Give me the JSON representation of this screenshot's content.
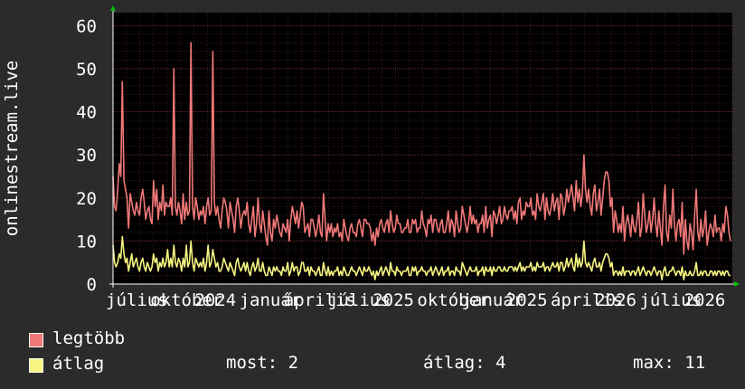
{
  "chart_data": {
    "type": "line",
    "ylabel": "onlinestream.live",
    "ylim": [
      0,
      63
    ],
    "yticks": [
      "0",
      "10",
      "20",
      "30",
      "40",
      "50",
      "60"
    ],
    "xticks": [
      "július",
      "október",
      "2024",
      "január",
      "április",
      "július",
      "2025",
      "október",
      "január",
      "2025",
      "április",
      "2026",
      "július",
      "2026"
    ],
    "grid": true,
    "series": [
      {
        "name": "legtöbb",
        "color": "#f07878",
        "values": [
          25,
          18,
          17,
          22,
          28,
          25,
          47,
          24,
          22,
          20,
          13,
          21,
          19,
          17,
          16,
          19,
          17,
          16,
          20,
          22,
          19,
          15,
          17,
          18,
          15,
          14,
          24,
          18,
          22,
          15,
          19,
          17,
          23,
          16,
          19,
          18,
          18,
          20,
          16,
          50,
          18,
          16,
          19,
          17,
          14,
          21,
          15,
          19,
          16,
          17,
          56,
          18,
          15,
          20,
          18,
          15,
          17,
          16,
          18,
          14,
          18,
          20,
          16,
          17,
          54,
          19,
          16,
          18,
          15,
          13,
          17,
          20,
          19,
          17,
          13,
          19,
          17,
          15,
          12,
          18,
          20,
          17,
          13,
          16,
          17,
          16,
          19,
          14,
          12,
          15,
          18,
          11,
          14,
          20,
          14,
          12,
          17,
          14,
          11,
          9,
          17,
          12,
          10,
          15,
          13,
          16,
          14,
          12,
          11,
          14,
          13,
          12,
          15,
          10,
          15,
          18,
          16,
          14,
          17,
          13,
          16,
          19,
          18,
          12,
          13,
          14,
          11,
          15,
          15,
          13,
          11,
          13,
          16,
          12,
          11,
          21,
          15,
          10,
          14,
          12,
          14,
          11,
          13,
          12,
          14,
          11,
          12,
          10,
          15,
          13,
          11,
          10,
          13,
          14,
          12,
          12,
          11,
          14,
          15,
          13,
          11,
          15,
          15,
          14,
          14,
          13,
          10,
          12,
          9,
          13,
          11,
          14,
          15,
          13,
          12,
          14,
          15,
          12,
          17,
          14,
          12,
          13,
          16,
          14,
          14,
          12,
          12,
          13,
          13,
          15,
          12,
          12,
          15,
          14,
          15,
          12,
          13,
          13,
          17,
          14,
          13,
          11,
          15,
          14,
          16,
          12,
          15,
          15,
          13,
          12,
          14,
          15,
          12,
          12,
          14,
          17,
          12,
          15,
          14,
          11,
          17,
          14,
          12,
          13,
          18,
          16,
          14,
          12,
          14,
          18,
          14,
          16,
          14,
          15,
          12,
          14,
          14,
          16,
          12,
          18,
          13,
          15,
          16,
          11,
          17,
          16,
          14,
          16,
          18,
          14,
          15,
          18,
          16,
          15,
          17,
          17,
          18,
          15,
          17,
          14,
          19,
          20,
          15,
          17,
          16,
          19,
          18,
          18,
          20,
          16,
          17,
          15,
          21,
          18,
          17,
          19,
          21,
          15,
          20,
          17,
          16,
          18,
          21,
          17,
          19,
          20,
          15,
          21,
          20,
          16,
          18,
          22,
          19,
          21,
          23,
          20,
          17,
          24,
          19,
          22,
          18,
          21,
          30,
          22,
          19,
          22,
          18,
          16,
          21,
          23,
          17,
          19,
          22,
          16,
          20,
          24,
          26,
          26,
          24,
          18,
          20,
          12,
          17,
          15,
          12,
          14,
          12,
          18,
          10,
          14,
          16,
          14,
          11,
          16,
          13,
          12,
          15,
          19,
          11,
          13,
          21,
          16,
          12,
          14,
          17,
          12,
          15,
          20,
          14,
          11,
          17,
          13,
          9,
          18,
          23,
          12,
          10,
          16,
          13,
          22,
          14,
          10,
          14,
          15,
          11,
          19,
          7,
          15,
          10,
          8,
          14,
          12,
          8,
          16,
          22,
          12,
          10,
          15,
          11,
          13,
          17,
          9,
          12,
          14,
          13,
          11,
          16,
          12,
          13,
          13,
          10,
          14,
          12,
          18,
          16,
          12,
          10
        ]
      },
      {
        "name": "átlag",
        "color": "#f5f580",
        "values": [
          9,
          5,
          4,
          5,
          7,
          6,
          11,
          7,
          5,
          6,
          3,
          5,
          7,
          4,
          5,
          6,
          4,
          3,
          5,
          6,
          4,
          3,
          5,
          4,
          3,
          4,
          7,
          5,
          6,
          3,
          5,
          4,
          6,
          4,
          5,
          8,
          4,
          6,
          4,
          9,
          5,
          4,
          6,
          5,
          3,
          6,
          4,
          9,
          4,
          5,
          10,
          5,
          3,
          6,
          5,
          4,
          5,
          4,
          6,
          3,
          5,
          9,
          4,
          5,
          8,
          6,
          4,
          5,
          3,
          3,
          4,
          6,
          5,
          4,
          3,
          5,
          4,
          3,
          2,
          5,
          6,
          4,
          3,
          4,
          5,
          3,
          5,
          3,
          2,
          4,
          5,
          3,
          4,
          6,
          3,
          3,
          5,
          3,
          2,
          2,
          4,
          3,
          2,
          4,
          3,
          4,
          3,
          3,
          2,
          4,
          3,
          3,
          5,
          2,
          3,
          5,
          3,
          4,
          4,
          2,
          3,
          5,
          5,
          3,
          3,
          4,
          2,
          4,
          3,
          3,
          2,
          3,
          4,
          2,
          2,
          5,
          3,
          2,
          4,
          2,
          3,
          2,
          3,
          3,
          4,
          2,
          3,
          2,
          4,
          3,
          2,
          2,
          3,
          4,
          3,
          3,
          2,
          3,
          4,
          3,
          2,
          4,
          3,
          3,
          4,
          3,
          2,
          3,
          1,
          3,
          2,
          3,
          4,
          2,
          3,
          4,
          3,
          2,
          5,
          3,
          3,
          2,
          4,
          3,
          3,
          2,
          3,
          3,
          3,
          4,
          2,
          2,
          4,
          3,
          4,
          2,
          3,
          3,
          4,
          3,
          3,
          2,
          3,
          3,
          4,
          2,
          3,
          4,
          3,
          2,
          3,
          4,
          2,
          3,
          3,
          4,
          2,
          3,
          3,
          2,
          4,
          3,
          3,
          2,
          5,
          4,
          3,
          2,
          3,
          4,
          3,
          3,
          3,
          4,
          2,
          3,
          3,
          4,
          2,
          4,
          3,
          3,
          4,
          2,
          4,
          3,
          3,
          4,
          4,
          3,
          3,
          4,
          3,
          3,
          4,
          4,
          4,
          3,
          4,
          3,
          4,
          5,
          3,
          4,
          3,
          4,
          4,
          4,
          5,
          3,
          4,
          3,
          5,
          4,
          4,
          4,
          5,
          3,
          4,
          4,
          3,
          4,
          5,
          4,
          4,
          5,
          3,
          5,
          5,
          3,
          4,
          6,
          4,
          5,
          6,
          4,
          3,
          7,
          4,
          6,
          4,
          5,
          10,
          5,
          4,
          5,
          4,
          3,
          5,
          6,
          4,
          4,
          5,
          3,
          5,
          6,
          7,
          7,
          6,
          4,
          5,
          2,
          3,
          3,
          2,
          3,
          2,
          4,
          2,
          3,
          3,
          3,
          2,
          3,
          3,
          2,
          3,
          4,
          2,
          3,
          4,
          3,
          2,
          3,
          3,
          2,
          3,
          4,
          3,
          2,
          3,
          3,
          1,
          3,
          4,
          2,
          2,
          3,
          3,
          4,
          3,
          2,
          3,
          3,
          2,
          4,
          1,
          3,
          2,
          2,
          3,
          2,
          2,
          3,
          5,
          2,
          2,
          3,
          2,
          3,
          3,
          2,
          2,
          3,
          3,
          2,
          3,
          2,
          3,
          3,
          2,
          3,
          2,
          3,
          3,
          2,
          2
        ]
      }
    ]
  },
  "legend": {
    "items": [
      {
        "label": "legtöbb",
        "color": "#f07878"
      },
      {
        "label": "átlag",
        "color": "#f5f580"
      }
    ],
    "stats": {
      "most": "most: 2",
      "atlag": "átlag: 4",
      "max": "max: 11"
    }
  },
  "colors": {
    "background": "#2b2b2b",
    "plot_background": "#000000",
    "grid": "#7a3030",
    "axis": "#ffffff",
    "arrow": "#00c000"
  }
}
